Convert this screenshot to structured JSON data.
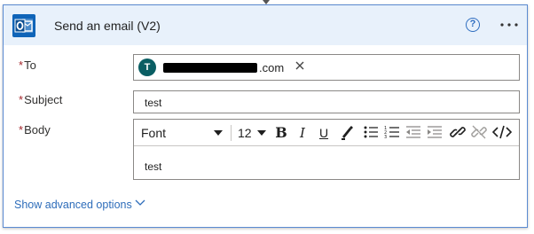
{
  "header": {
    "title": "Send an email (V2)",
    "app_icon": "outlook-icon",
    "help_icon": "help-icon",
    "more_icon": "more-options-icon"
  },
  "fields": {
    "to": {
      "label": "To",
      "required_marker": "*",
      "recipient": {
        "avatar_initial": "T",
        "email_suffix": ".com",
        "remove_icon": "close-icon"
      }
    },
    "subject": {
      "label": "Subject",
      "required_marker": "*",
      "value": "test"
    },
    "body": {
      "label": "Body",
      "required_marker": "*",
      "value": "test",
      "toolbar": {
        "font": "Font",
        "font_size": "12",
        "bold": "B",
        "italic": "I",
        "underline": "U",
        "buttons": [
          "font-color-icon",
          "bulleted-list-icon",
          "numbered-list-icon",
          "decrease-indent-icon",
          "increase-indent-icon",
          "insert-link-icon",
          "remove-link-icon",
          "code-view-icon"
        ]
      }
    }
  },
  "footer": {
    "advanced_options_label": "Show advanced options"
  },
  "colors": {
    "header_bg": "#e8f1fb",
    "card_border": "#5b8bd2",
    "required": "#a4262c",
    "link": "#2e6dba",
    "avatar": "#0a5e63",
    "outlook_blue": "#0f64b8"
  }
}
